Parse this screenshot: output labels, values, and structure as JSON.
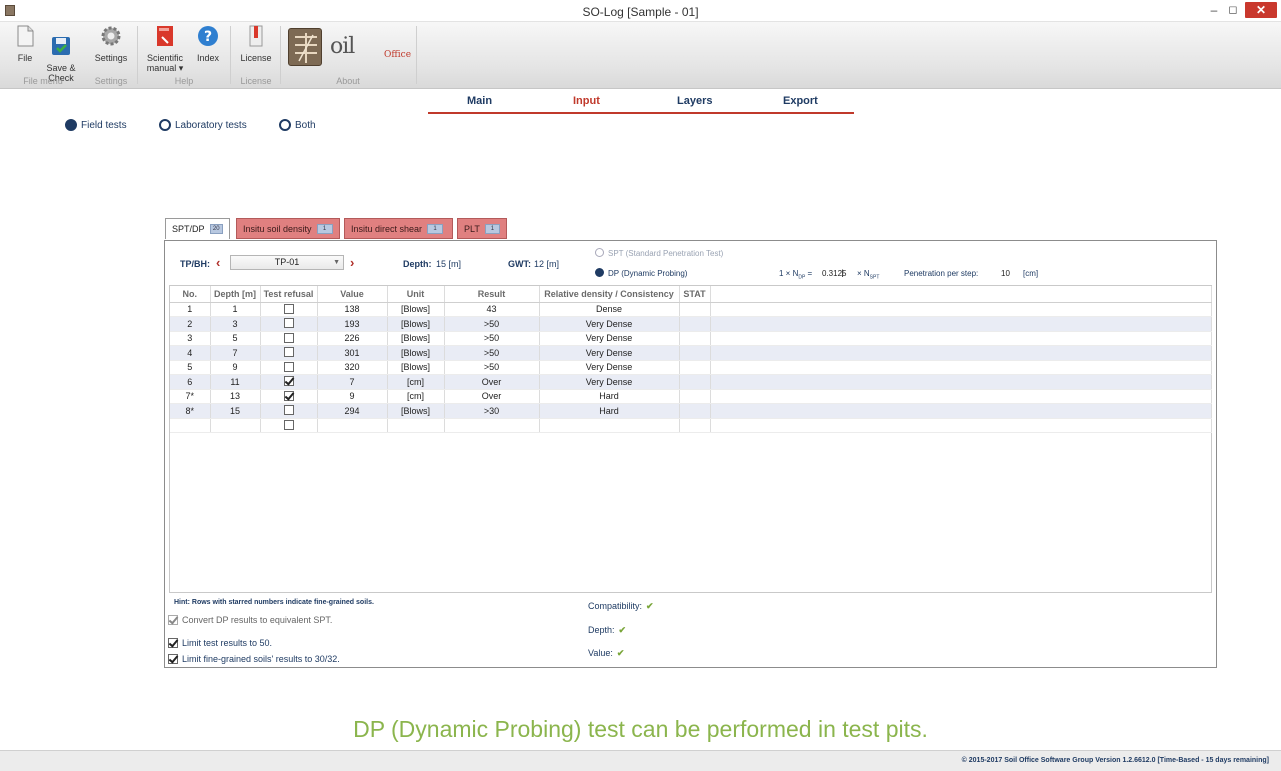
{
  "window": {
    "title": "SO-Log [Sample - 01]",
    "controls": {
      "minimize": "–",
      "maximize": "◻",
      "close": "✕"
    }
  },
  "ribbon": {
    "buttons": {
      "file": "File",
      "save_check": "Save &\nCheck",
      "settings": "Settings",
      "scientific_manual": "Scientific\nmanual ▾",
      "index": "Index",
      "license": "License"
    },
    "groups": {
      "file_menu": "File menu",
      "settings": "Settings",
      "help": "Help",
      "license": "License",
      "about": "About"
    },
    "logo": {
      "soil": "oil",
      "office": "Office"
    }
  },
  "nav": {
    "tabs": [
      "Main",
      "Input",
      "Layers",
      "Export"
    ],
    "active": "Input"
  },
  "test_type": {
    "options": [
      "Field tests",
      "Laboratory tests",
      "Both"
    ],
    "selected": "Field tests"
  },
  "subtabs": [
    {
      "label": "SPT/DP",
      "count": "20",
      "active": true
    },
    {
      "label": "Insitu soil density",
      "count": "1",
      "active": false
    },
    {
      "label": "Insitu direct shear",
      "count": "1",
      "active": false
    },
    {
      "label": "PLT",
      "count": "1",
      "active": false
    }
  ],
  "form": {
    "tp_bh_label": "TP/BH:",
    "tp_bh_value": "TP-01",
    "depth_label": "Depth:",
    "depth_value": "15 [m]",
    "gwt_label": "GWT:",
    "gwt_value": "12 [m]",
    "spt_option": "SPT (Standard Penetration Test)",
    "dp_option": "DP (Dynamic Probing)",
    "method_selected": "DP (Dynamic Probing)",
    "ndp_prefix": "1 × N",
    "ndp_sub": "DP",
    "ndp_eq": "=",
    "factor": "0.3125",
    "nspt_prefix": "× N",
    "nspt_sub": "SPT",
    "penetration_label": "Penetration per step:",
    "penetration_value": "10",
    "penetration_unit": "[cm]"
  },
  "table": {
    "headers": [
      "No.",
      "Depth [m]",
      "Test refusal",
      "Value",
      "Unit",
      "Result",
      "Relative density / Consistency",
      "STAT"
    ],
    "rows": [
      {
        "no": "1",
        "depth": "1",
        "refusal": false,
        "value": "138",
        "unit": "[Blows]",
        "result": "43",
        "density": "Dense"
      },
      {
        "no": "2",
        "depth": "3",
        "refusal": false,
        "value": "193",
        "unit": "[Blows]",
        "result": ">50",
        "density": "Very Dense"
      },
      {
        "no": "3",
        "depth": "5",
        "refusal": false,
        "value": "226",
        "unit": "[Blows]",
        "result": ">50",
        "density": "Very Dense"
      },
      {
        "no": "4",
        "depth": "7",
        "refusal": false,
        "value": "301",
        "unit": "[Blows]",
        "result": ">50",
        "density": "Very Dense"
      },
      {
        "no": "5",
        "depth": "9",
        "refusal": false,
        "value": "320",
        "unit": "[Blows]",
        "result": ">50",
        "density": "Very Dense"
      },
      {
        "no": "6",
        "depth": "11",
        "refusal": true,
        "value": "7",
        "unit": "[cm]",
        "result": "Over",
        "density": "Very Dense"
      },
      {
        "no": "7*",
        "depth": "13",
        "refusal": true,
        "value": "9",
        "unit": "[cm]",
        "result": "Over",
        "density": "Hard"
      },
      {
        "no": "8*",
        "depth": "15",
        "refusal": false,
        "value": "294",
        "unit": "[Blows]",
        "result": ">30",
        "density": "Hard"
      },
      {
        "no": "",
        "depth": "",
        "refusal": false,
        "value": "",
        "unit": "",
        "result": "",
        "density": ""
      }
    ]
  },
  "hint": "Hint: Rows with starred numbers indicate fine-grained soils.",
  "options": [
    {
      "label": "Convert DP results to equivalent SPT.",
      "checked": true,
      "disabled": true
    },
    {
      "label": "Limit test results to 50.",
      "checked": true,
      "disabled": false
    },
    {
      "label": "Limit fine-grained soils' results to 30/32.",
      "checked": true,
      "disabled": false
    }
  ],
  "checks": {
    "compatibility": "Compatibility:",
    "depth": "Depth:",
    "value": "Value:",
    "ok_mark": "✔"
  },
  "caption": "DP (Dynamic Probing) test can be performed in test pits.",
  "status_bar": "© 2015-2017 Soil Office Software Group   Version 1.2.6612.0 [Time-Based - 15 days remaining]",
  "colors": {
    "navy": "#1f3b63",
    "accent_red": "#c0392b",
    "inactive_tab": "#e08080",
    "caption_green": "#8bb54d",
    "alt_row": "#e9ecf5"
  }
}
